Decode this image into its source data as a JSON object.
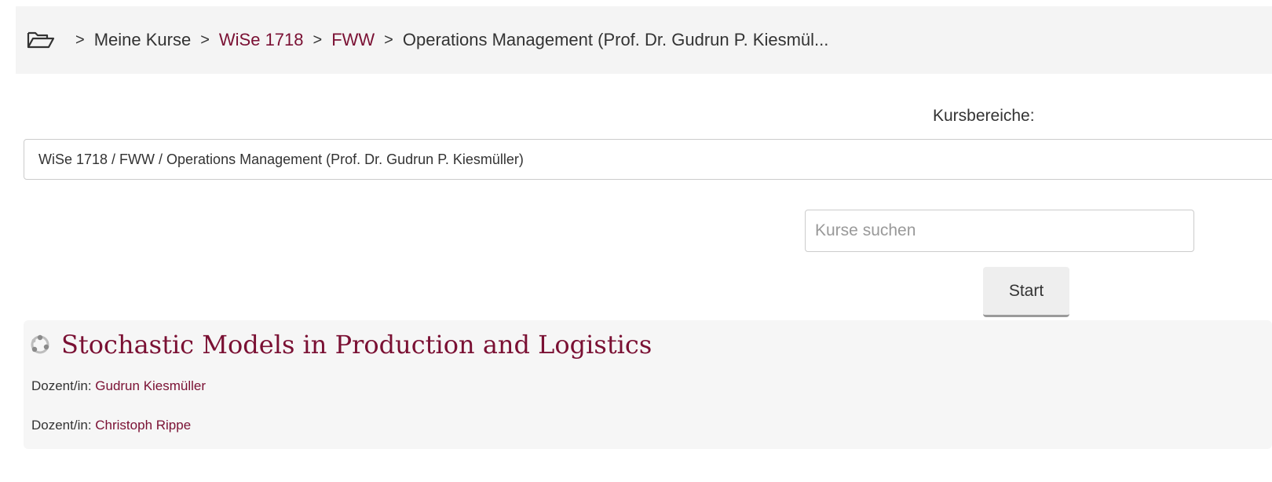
{
  "breadcrumb": {
    "home_icon": "folder-open-icon",
    "items": [
      {
        "label": "Meine Kurse",
        "link": false
      },
      {
        "label": "WiSe 1718",
        "link": true
      },
      {
        "label": "FWW",
        "link": true
      },
      {
        "label": "Operations Management (Prof. Dr. Gudrun P. Kiesmül...",
        "link": false
      }
    ],
    "separator": ">"
  },
  "categories": {
    "label": "Kursbereiche:",
    "selected": "WiSe 1718 / FWW / Operations Management (Prof. Dr. Gudrun P. Kiesmüller)"
  },
  "search": {
    "placeholder": "Kurse suchen",
    "value": "",
    "button_label": "Start"
  },
  "course": {
    "icon": "course-icon",
    "title": "Stochastic Models in Production and Logistics",
    "teachers": [
      {
        "role": "Dozent/in: ",
        "name": "Gudrun Kiesmüller"
      },
      {
        "role": "Dozent/in: ",
        "name": "Christoph Rippe"
      }
    ]
  },
  "colors": {
    "accent": "#7a1033",
    "breadcrumb_background": "#f4f4f4",
    "course_background": "#f6f6f6"
  }
}
